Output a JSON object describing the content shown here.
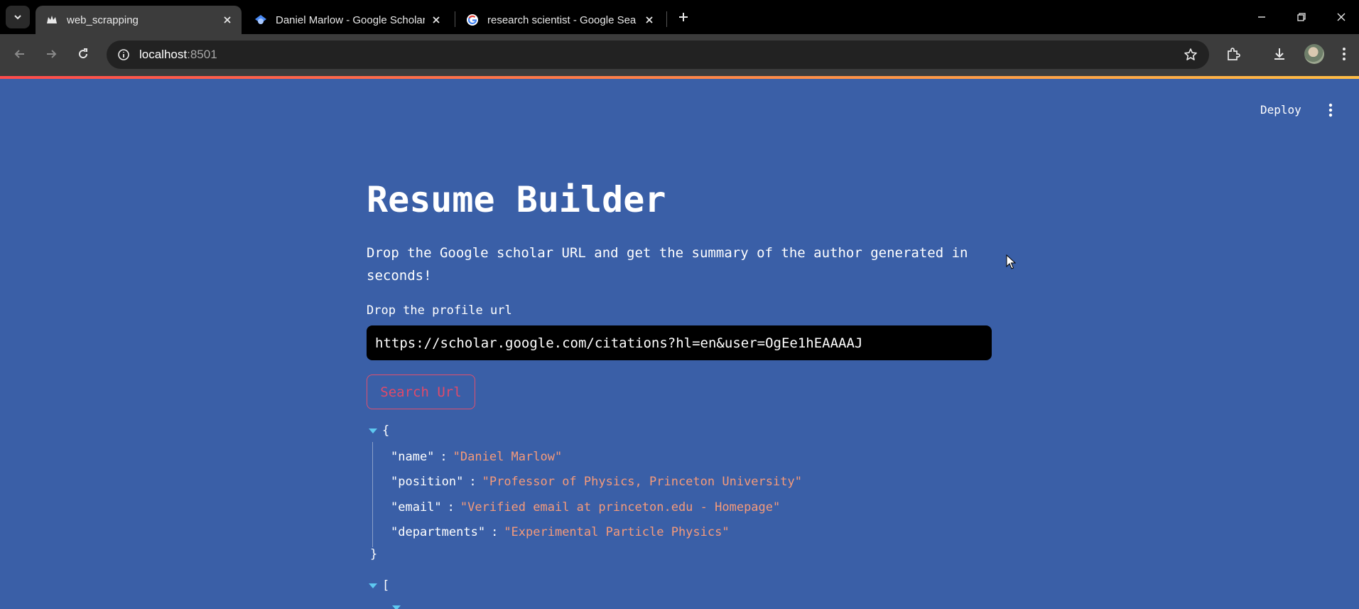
{
  "browser": {
    "tabs": [
      {
        "title": "web_scrapping",
        "favicon": "streamlit-crown-icon",
        "active": true
      },
      {
        "title": "Daniel Marlow - Google Scholar",
        "favicon": "google-scholar-icon",
        "active": false
      },
      {
        "title": "research scientist - Google Search",
        "favicon": "google-g-icon",
        "active": false
      }
    ],
    "address": {
      "host": "localhost",
      "port": ":8501"
    }
  },
  "app": {
    "deploy_label": "Deploy",
    "title": "Resume Builder",
    "subtitle": "Drop the Google scholar URL and get the summary of the author generated in seconds!",
    "input_label": "Drop the profile url",
    "input_value": "https://scholar.google.com/citations?hl=en&user=OgEe1hEAAAAJ",
    "button_label": "Search Url",
    "json_open": "{",
    "json_close": "}",
    "json_fields": [
      {
        "key": "\"name\"",
        "value": "\"Daniel Marlow\""
      },
      {
        "key": "\"position\"",
        "value": "\"Professor of Physics, Princeton University\""
      },
      {
        "key": "\"email\"",
        "value": "\"Verified email at princeton.edu - Homepage\""
      },
      {
        "key": "\"departments\"",
        "value": "\"Experimental Particle Physics\""
      }
    ],
    "json2_open": "["
  },
  "colors": {
    "app_background": "#3a5fa7",
    "button_accent": "#e04a6a",
    "json_value": "#f59a7a",
    "json_caret": "#5ec8f0"
  }
}
